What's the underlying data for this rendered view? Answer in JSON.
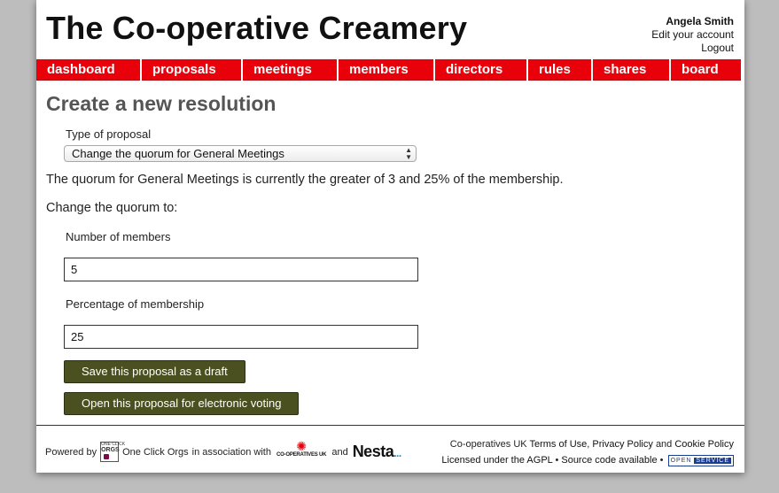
{
  "header": {
    "site_title": "The Co-operative Creamery",
    "user_name": "Angela Smith",
    "edit_account": "Edit your account",
    "logout": "Logout"
  },
  "nav": {
    "items": [
      {
        "label": "dashboard"
      },
      {
        "label": "proposals"
      },
      {
        "label": "meetings"
      },
      {
        "label": "members"
      },
      {
        "label": "directors"
      },
      {
        "label": "rules"
      },
      {
        "label": "shares"
      },
      {
        "label": "board"
      }
    ]
  },
  "main": {
    "title": "Create a new resolution",
    "type_label": "Type of proposal",
    "type_selected": "Change the quorum for General Meetings",
    "current_quorum_text": "The quorum for General Meetings is currently the greater of 3 and 25% of the membership.",
    "change_to_text": "Change the quorum to:",
    "members_label": "Number of members",
    "members_value": "5",
    "percentage_label": "Percentage of membership",
    "percentage_value": "25",
    "save_draft_label": "Save this proposal as a draft",
    "open_voting_label": "Open this proposal for electronic voting"
  },
  "footer": {
    "powered_by": "Powered by",
    "oco_logo_top": "ONE CLICK",
    "oco_logo_mid": "ORGS",
    "one_click_orgs": "One Click Orgs",
    "association": "in association with",
    "coop_logo_text": "CO-OPERATIVES UK",
    "and": "and",
    "nesta": "Nesta",
    "nesta_dots": "...",
    "coop_uk": "Co-operatives UK",
    "terms": "Terms of Use",
    "comma": ",",
    "privacy": "Privacy Policy",
    "and2": "and",
    "cookie": "Cookie Policy",
    "licensed": "Licensed under the AGPL",
    "bullet": "•",
    "source": "Source code available",
    "open_label": "OPEN",
    "service_label": "SERVICE"
  },
  "colors": {
    "nav_red": "#e8000b",
    "button_olive": "#4b5020",
    "title_gray": "#555555"
  }
}
